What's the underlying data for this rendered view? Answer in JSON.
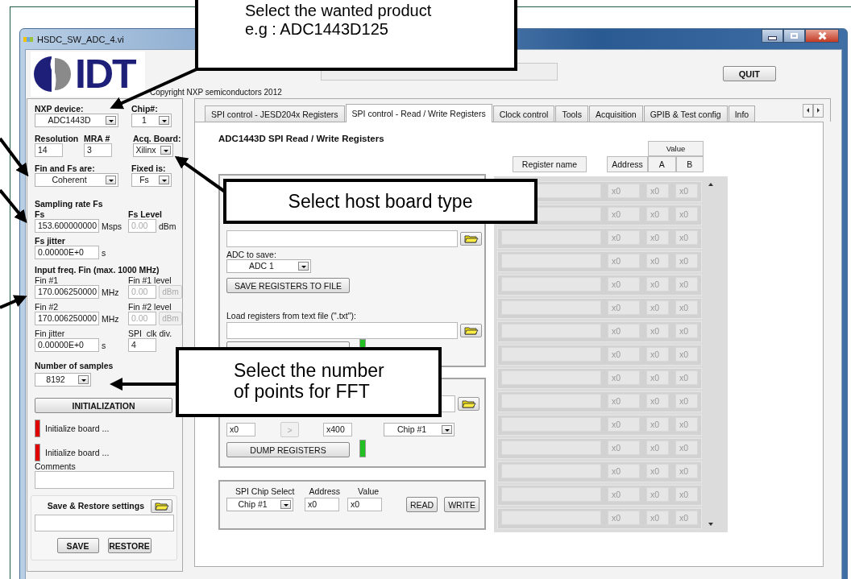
{
  "window": {
    "title": "HSDC_SW_ADC_4.vi"
  },
  "header": {
    "logo": "IDT",
    "copyright": "Copyright NXP semiconductors 2012",
    "quit": "QUIT"
  },
  "settings": {
    "nxp_device": {
      "label": "NXP device:",
      "value": "ADC1443D"
    },
    "chip": {
      "label": "Chip#:",
      "value": "1"
    },
    "resolution": {
      "label": "Resolution",
      "value": "14"
    },
    "mra": {
      "label": "MRA #",
      "value": "3"
    },
    "acq_board": {
      "label": "Acq. Board:",
      "value": "Xilinx"
    },
    "fin_fs": {
      "label": "Fin and Fs are:",
      "value": "Coherent"
    },
    "fixed": {
      "label": "Fixed is:",
      "value": "Fs"
    },
    "sampling_title": "Sampling rate Fs",
    "fs": {
      "label": "Fs",
      "value": "153.600000000",
      "unit": "Msps"
    },
    "fs_level": {
      "label": "Fs Level",
      "value": "0.00",
      "unit": "dBm",
      "disabled": true
    },
    "fs_jitter": {
      "label": "Fs jitter",
      "value": "0.00000E+0",
      "unit": "s"
    },
    "input_title": "Input freq. Fin (max. 1000 MHz)",
    "fins": [
      {
        "label": "Fin #1",
        "value": "170.006250000",
        "unit": "MHz",
        "level_label": "Fin #1 level",
        "level_value": "0.00",
        "level_unit": "dBm",
        "disabled": true
      },
      {
        "label": "Fin #2",
        "value": "170.006250000",
        "unit": "MHz",
        "level_label": "Fin #2 level",
        "level_value": "0.00",
        "level_unit": "dBm",
        "disabled": true
      }
    ],
    "fin_jitter": {
      "label": "Fin jitter",
      "value": "0.00000E+0",
      "unit": "s"
    },
    "spi_clk_div": {
      "label": "SPI  clk div.",
      "value": "4"
    },
    "samples": {
      "label": "Number of samples",
      "value": "8192"
    },
    "init_button": "INITIALIZATION",
    "status": [
      {
        "text": "Initialize board ...",
        "color": "#e00000"
      },
      {
        "text": "Initialize board ...",
        "color": "#e00000"
      }
    ],
    "comments": {
      "label": "Comments"
    },
    "save_restore": {
      "title": "Save & Restore settings",
      "buttons": [
        "SAVE",
        "RESTORE"
      ]
    }
  },
  "tabs": [
    {
      "label": "SPI control - JESD204x Registers",
      "selected": false
    },
    {
      "label": "SPI control - Read / Write Registers",
      "selected": true
    },
    {
      "label": "Clock control",
      "selected": false
    },
    {
      "label": "Tools",
      "selected": false
    },
    {
      "label": "Acquisition",
      "selected": false
    },
    {
      "label": "GPIB & Test config",
      "selected": false
    },
    {
      "label": "Info",
      "selected": false
    }
  ],
  "page": {
    "heading": "ADC1443D SPI Read / Write Registers",
    "save_panel": {
      "adc_label": "ADC to save:",
      "adc_value": "ADC 1",
      "save_button": "SAVE REGISTERS TO FILE",
      "load_label": "Load registers from text file (\".txt\"):",
      "led_on": true
    },
    "dump_panel": {
      "start": "x0",
      "next": ">",
      "next_disabled": true,
      "end": "x400",
      "chip": "Chip #1",
      "button": "DUMP REGISTERS",
      "led_on": true
    },
    "rw_panel": {
      "chip_label": "SPI Chip Select",
      "address_label": "Address",
      "value_label": "Value",
      "chip": "Chip #1",
      "address": "x0",
      "value": "x0",
      "buttons": [
        "READ",
        "WRITE"
      ]
    },
    "table": {
      "group": "Value",
      "columns": [
        "Register name",
        "Address",
        "A",
        "B"
      ],
      "rows": [
        {
          "address": "x0",
          "a": "x0",
          "b": "x0"
        },
        {
          "address": "x0",
          "a": "x0",
          "b": "x0"
        },
        {
          "address": "x0",
          "a": "x0",
          "b": "x0"
        },
        {
          "address": "x0",
          "a": "x0",
          "b": "x0"
        },
        {
          "address": "x0",
          "a": "x0",
          "b": "x0"
        },
        {
          "address": "x0",
          "a": "x0",
          "b": "x0"
        },
        {
          "address": "x0",
          "a": "x0",
          "b": "x0"
        },
        {
          "address": "x0",
          "a": "x0",
          "b": "x0"
        },
        {
          "address": "x0",
          "a": "x0",
          "b": "x0"
        },
        {
          "address": "x0",
          "a": "x0",
          "b": "x0"
        },
        {
          "address": "x0",
          "a": "x0",
          "b": "x0"
        },
        {
          "address": "x0",
          "a": "x0",
          "b": "x0"
        },
        {
          "address": "x0",
          "a": "x0",
          "b": "x0"
        },
        {
          "address": "x0",
          "a": "x0",
          "b": "x0"
        },
        {
          "address": "x0",
          "a": "x0",
          "b": "x0"
        }
      ]
    }
  },
  "callouts": [
    {
      "lines": [
        "Select the wanted product",
        "e.g : ADC1443D125"
      ]
    },
    {
      "lines": [
        "Select host board type"
      ]
    },
    {
      "lines": [
        "Select the number",
        "of points for FFT"
      ]
    }
  ]
}
